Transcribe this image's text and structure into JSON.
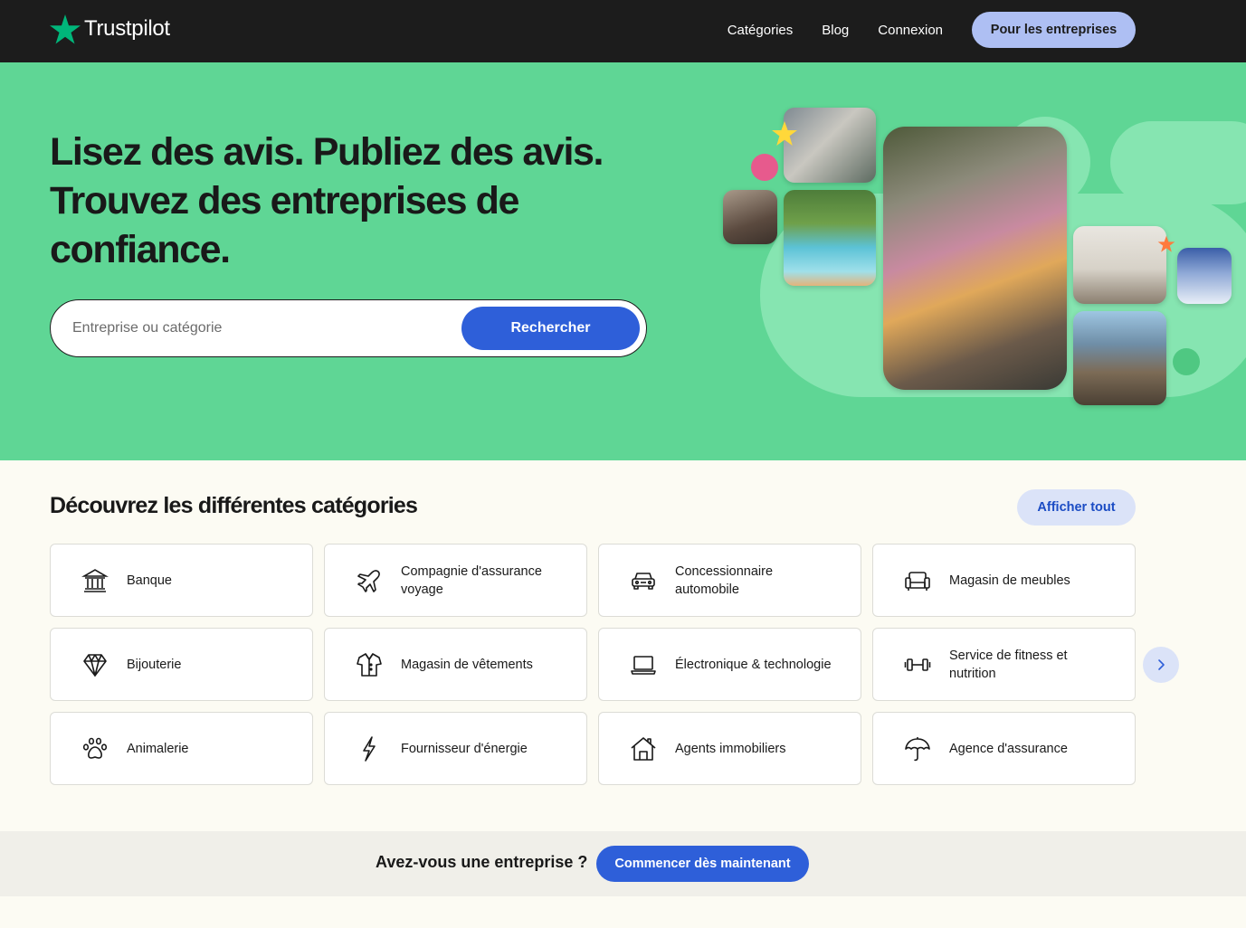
{
  "header": {
    "logo_text": "Trustpilot",
    "nav": [
      "Catégories",
      "Blog",
      "Connexion"
    ],
    "cta": "Pour les entreprises"
  },
  "hero": {
    "title_line1": "Lisez des avis. Publiez des avis.",
    "title_line2": "Trouvez des entreprises de",
    "title_line3": "confiance.",
    "search_placeholder": "Entreprise ou catégorie",
    "search_button": "Rechercher"
  },
  "categories": {
    "title": "Découvrez les différentes catégories",
    "show_all": "Afficher tout",
    "items": [
      {
        "label": "Banque",
        "icon": "bank-icon"
      },
      {
        "label": "Compagnie d'assurance voyage",
        "icon": "airplane-icon"
      },
      {
        "label": "Concessionnaire automobile",
        "icon": "car-icon"
      },
      {
        "label": "Magasin de meubles",
        "icon": "sofa-icon"
      },
      {
        "label": "Bijouterie",
        "icon": "diamond-icon"
      },
      {
        "label": "Magasin de vêtements",
        "icon": "shirt-icon"
      },
      {
        "label": "Électronique & technologie",
        "icon": "laptop-icon"
      },
      {
        "label": "Service de fitness et nutrition",
        "icon": "dumbbell-icon"
      },
      {
        "label": "Animalerie",
        "icon": "paw-icon"
      },
      {
        "label": "Fournisseur d'énergie",
        "icon": "lightning-icon"
      },
      {
        "label": "Agents immobiliers",
        "icon": "house-icon"
      },
      {
        "label": "Agence d'assurance",
        "icon": "umbrella-icon"
      }
    ]
  },
  "business_band": {
    "text": "Avez-vous une entreprise ?",
    "button": "Commencer dès maintenant"
  },
  "colors": {
    "header_bg": "#1c1c1c",
    "hero_bg": "#5fd695",
    "brand_green": "#00b67a",
    "primary_blue": "#2e5fd9",
    "light_blue": "#aebff3",
    "page_bg": "#fcfbf3"
  }
}
